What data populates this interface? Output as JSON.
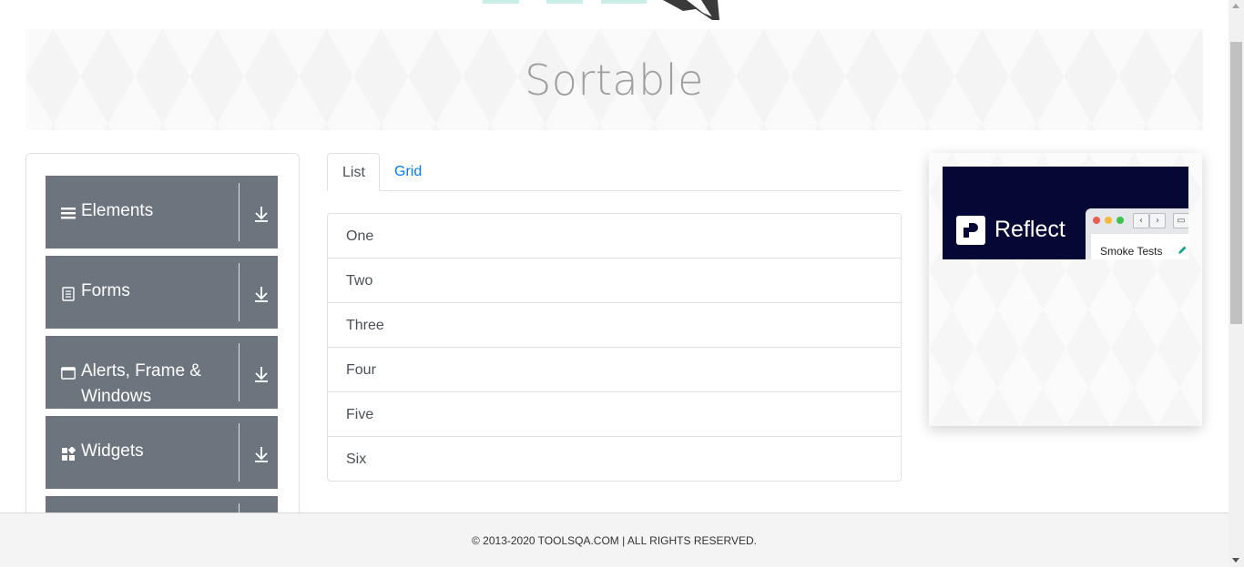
{
  "page": {
    "title": "Sortable"
  },
  "sidebar": {
    "groups": [
      {
        "label": "Elements",
        "icon": "hamburger-icon"
      },
      {
        "label": "Forms",
        "icon": "document-icon"
      },
      {
        "label": "Alerts, Frame & Windows",
        "icon": "window-icon"
      },
      {
        "label": "Widgets",
        "icon": "widgets-icon"
      },
      {
        "label": "",
        "icon": ""
      }
    ],
    "expand_icon": "download-arrow-icon",
    "header_color": "#6c757d"
  },
  "tabs": {
    "items": [
      "List",
      "Grid"
    ],
    "active": "List",
    "link_color": "#007bff"
  },
  "sortable_list": {
    "items": [
      "One",
      "Two",
      "Three",
      "Four",
      "Five",
      "Six"
    ]
  },
  "ad": {
    "brand": "Reflect",
    "browser_tab_text": "Smoke Tests",
    "background": "#050835"
  },
  "footer": {
    "copyright": "© 2013-2020 TOOLSQA.COM | ALL RIGHTS RESERVED."
  }
}
